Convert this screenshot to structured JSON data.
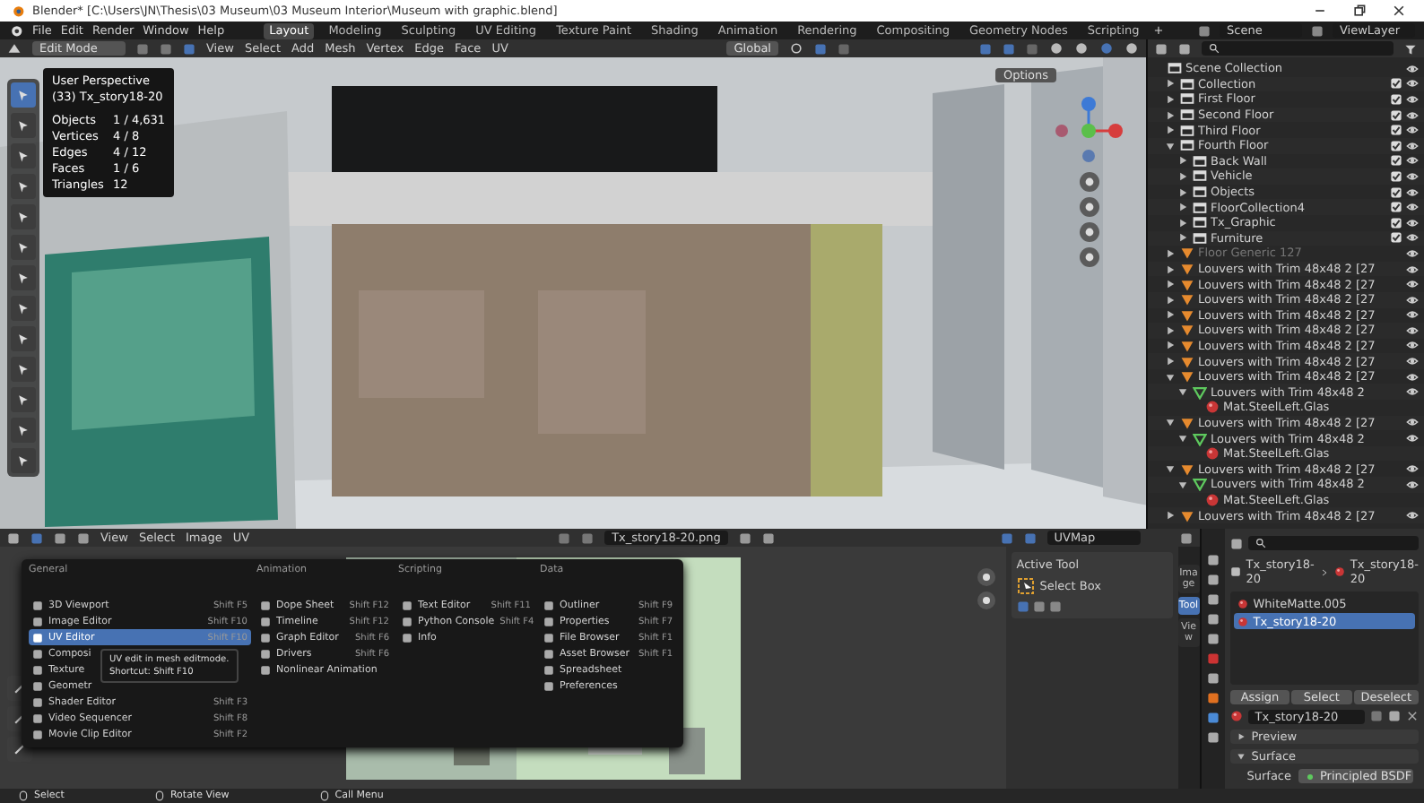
{
  "window": {
    "title": "Blender* [C:\\Users\\JN\\Thesis\\03 Museum\\03 Museum Interior\\Museum with graphic.blend]"
  },
  "menubar": {
    "menus": [
      "File",
      "Edit",
      "Render",
      "Window",
      "Help"
    ],
    "workspaces": [
      {
        "label": "Layout",
        "selected": true
      },
      {
        "label": "Modeling",
        "selected": false
      },
      {
        "label": "Sculpting",
        "selected": false
      },
      {
        "label": "UV Editing",
        "selected": false
      },
      {
        "label": "Texture Paint",
        "selected": false
      },
      {
        "label": "Shading",
        "selected": false
      },
      {
        "label": "Animation",
        "selected": false
      },
      {
        "label": "Rendering",
        "selected": false
      },
      {
        "label": "Compositing",
        "selected": false
      },
      {
        "label": "Geometry Nodes",
        "selected": false
      },
      {
        "label": "Scripting",
        "selected": false
      }
    ],
    "add_workspace": "+",
    "scene": "Scene",
    "view_layer": "ViewLayer"
  },
  "viewport": {
    "mode": "Edit Mode",
    "menus": [
      "View",
      "Select",
      "Add",
      "Mesh",
      "Vertex",
      "Edge",
      "Face",
      "UV"
    ],
    "orientation": "Global",
    "options": "Options",
    "overlay": [
      "User Perspective",
      "(33) Tx_story18-20"
    ],
    "stats": [
      {
        "label": "Objects",
        "value": "1 / 4,631"
      },
      {
        "label": "Vertices",
        "value": "4 / 8"
      },
      {
        "label": "Edges",
        "value": "4 / 12"
      },
      {
        "label": "Faces",
        "value": "1 / 6"
      },
      {
        "label": "Triangles",
        "value": "12"
      }
    ],
    "tools": [
      {
        "selected": true
      },
      {
        "selected": false
      },
      {
        "selected": false
      },
      {
        "selected": false
      },
      {
        "selected": false
      },
      {
        "selected": false
      },
      {
        "selected": false
      },
      {
        "selected": false
      },
      {
        "selected": false
      },
      {
        "selected": false
      },
      {
        "selected": false
      },
      {
        "selected": false
      },
      {
        "selected": false
      }
    ]
  },
  "outliner": {
    "items": [
      {
        "name": "Scene Collection",
        "kind": "collection",
        "children": [
          {
            "name": "Collection",
            "kind": "collection",
            "expanded": false,
            "checked": true
          },
          {
            "name": "First Floor",
            "kind": "collection",
            "expanded": false,
            "checked": true
          },
          {
            "name": "Second Floor",
            "kind": "collection",
            "expanded": false,
            "checked": true
          },
          {
            "name": "Third Floor",
            "kind": "collection",
            "expanded": false,
            "checked": true
          },
          {
            "name": "Fourth Floor",
            "kind": "collection",
            "expanded": true,
            "checked": true,
            "children": [
              {
                "name": "Back Wall",
                "kind": "collection",
                "expanded": false,
                "checked": true
              },
              {
                "name": "Vehicle",
                "kind": "collection",
                "expanded": false,
                "checked": true
              },
              {
                "name": "Objects",
                "kind": "collection",
                "expanded": false,
                "checked": true
              },
              {
                "name": "FloorCollection4",
                "kind": "collection",
                "expanded": false,
                "checked": true
              },
              {
                "name": "Tx_Graphic",
                "kind": "collection",
                "expanded": false,
                "checked": true
              },
              {
                "name": "Furniture",
                "kind": "collection",
                "expanded": false,
                "checked": true
              }
            ]
          },
          {
            "name": "Floor Generic 127",
            "kind": "mesh",
            "expanded": false,
            "disabled": true
          },
          {
            "name": "Louvers with Trim 48x48 2 [27",
            "kind": "mesh",
            "expanded": false
          },
          {
            "name": "Louvers with Trim 48x48 2 [27",
            "kind": "mesh",
            "expanded": false
          },
          {
            "name": "Louvers with Trim 48x48 2 [27",
            "kind": "mesh",
            "expanded": false
          },
          {
            "name": "Louvers with Trim 48x48 2 [27",
            "kind": "mesh",
            "expanded": false
          },
          {
            "name": "Louvers with Trim 48x48 2 [27",
            "kind": "mesh",
            "expanded": false
          },
          {
            "name": "Louvers with Trim 48x48 2 [27",
            "kind": "mesh",
            "expanded": false
          },
          {
            "name": "Louvers with Trim 48x48 2 [27",
            "kind": "mesh",
            "expanded": false
          },
          {
            "name": "Louvers with Trim 48x48 2 [27",
            "kind": "mesh",
            "expanded": true,
            "children": [
              {
                "name": "Louvers with Trim 48x48 2",
                "kind": "data",
                "expanded": true,
                "children": [
                  {
                    "name": "Mat.SteelLeft.Glas",
                    "kind": "material"
                  }
                ]
              }
            ]
          },
          {
            "name": "Louvers with Trim 48x48 2 [27",
            "kind": "mesh",
            "expanded": true,
            "children": [
              {
                "name": "Louvers with Trim 48x48 2",
                "kind": "data",
                "expanded": true,
                "children": [
                  {
                    "name": "Mat.SteelLeft.Glas",
                    "kind": "material"
                  }
                ]
              }
            ]
          },
          {
            "name": "Louvers with Trim 48x48 2 [27",
            "kind": "mesh",
            "expanded": true,
            "children": [
              {
                "name": "Louvers with Trim 48x48 2",
                "kind": "data",
                "expanded": true,
                "children": [
                  {
                    "name": "Mat.SteelLeft.Glas",
                    "kind": "material"
                  }
                ]
              }
            ]
          },
          {
            "name": "Louvers with Trim 48x48 2 [27",
            "kind": "mesh",
            "expanded": false
          }
        ]
      }
    ]
  },
  "image_editor": {
    "menus": [
      "View",
      "Select",
      "Image",
      "UV"
    ],
    "image": "Tx_story18-20.png",
    "uv_map": "UVMap",
    "editor_menu": {
      "columns": [
        {
          "heading": "General",
          "items": [
            {
              "label": "3D Viewport",
              "shortcut": "Shift F5",
              "selected": false
            },
            {
              "label": "Image Editor",
              "shortcut": "Shift F10",
              "selected": false
            },
            {
              "label": "UV Editor",
              "shortcut": "Shift F10",
              "selected": true
            },
            {
              "label": "Composi",
              "selected": false
            },
            {
              "label": "Texture",
              "selected": false
            },
            {
              "label": "Geometr",
              "selected": false
            },
            {
              "label": "Shader Editor",
              "shortcut": "Shift F3",
              "selected": false
            },
            {
              "label": "Video Sequencer",
              "shortcut": "Shift F8",
              "selected": false
            },
            {
              "label": "Movie Clip Editor",
              "shortcut": "Shift F2",
              "selected": false
            }
          ]
        },
        {
          "heading": "Animation",
          "items": [
            {
              "label": "Dope Sheet",
              "shortcut": "Shift F12",
              "selected": false
            },
            {
              "label": "Timeline",
              "shortcut": "Shift F12",
              "selected": false
            },
            {
              "label": "Graph Editor",
              "shortcut": "Shift F6",
              "selected": false
            },
            {
              "label": "Drivers",
              "shortcut": "Shift F6",
              "selected": false
            },
            {
              "label": "Nonlinear Animation",
              "selected": false
            }
          ]
        },
        {
          "heading": "Scripting",
          "items": [
            {
              "label": "Text Editor",
              "shortcut": "Shift F11",
              "selected": false
            },
            {
              "label": "Python Console",
              "shortcut": "Shift F4",
              "selected": false
            },
            {
              "label": "Info",
              "selected": false
            }
          ]
        },
        {
          "heading": "Data",
          "items": [
            {
              "label": "Outliner",
              "shortcut": "Shift F9",
              "selected": false
            },
            {
              "label": "Properties",
              "shortcut": "Shift F7",
              "selected": false
            },
            {
              "label": "File Browser",
              "shortcut": "Shift F1",
              "selected": false
            },
            {
              "label": "Asset Browser",
              "shortcut": "Shift F1",
              "selected": false
            },
            {
              "label": "Spreadsheet",
              "selected": false
            },
            {
              "label": "Preferences",
              "selected": false
            }
          ]
        }
      ],
      "tooltip": {
        "text": "UV edit in mesh editmode.",
        "shortcut": "Shortcut: Shift F10"
      }
    },
    "sidebar": {
      "panel": "Active Tool",
      "tool": "Select Box",
      "tabs": [
        {
          "label": "Image",
          "selected": false
        },
        {
          "label": "Tool",
          "selected": true
        },
        {
          "label": "View",
          "selected": false
        }
      ]
    }
  },
  "properties": {
    "object": "Tx_story18-20",
    "material": "Tx_story18-20",
    "slots": [
      {
        "name": "WhiteMatte.005",
        "selected": false
      },
      {
        "name": "Tx_story18-20",
        "selected": true
      }
    ],
    "buttons": [
      "Assign",
      "Select",
      "Deselect"
    ],
    "material_field": "Tx_story18-20",
    "sections": [
      {
        "title": "Preview",
        "expanded": false
      },
      {
        "title": "Surface",
        "expanded": true
      }
    ],
    "surface_label": "Surface",
    "surface_value": "Principled BSDF"
  },
  "status_bar": [
    "Select",
    "Rotate View",
    "Call Menu"
  ]
}
